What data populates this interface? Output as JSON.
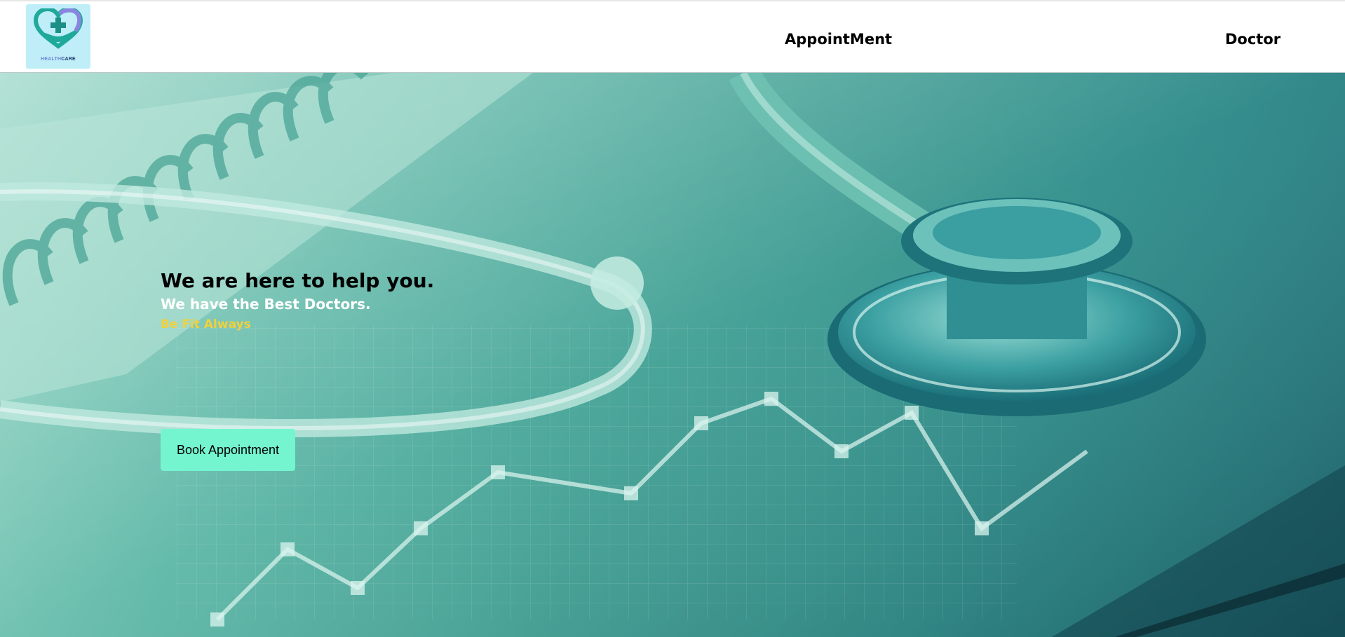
{
  "brand": {
    "logo_word_a": "HEALTH",
    "logo_word_b": "CARE"
  },
  "nav": {
    "items": [
      {
        "label": "AppointMent"
      },
      {
        "label": "Doctor"
      }
    ]
  },
  "hero": {
    "title": "We are here to help you.",
    "subtitle": "We have the Best Doctors.",
    "tagline": "Be Fit Always",
    "cta_label": "Book Appointment"
  },
  "colors": {
    "cta_background": "#74f5d0",
    "tagline": "#f2d13a",
    "hero_teal": "#3f9f93",
    "logo_bg": "#bfeef8"
  },
  "icons": {
    "logo": "heart-cross-hand-icon"
  }
}
